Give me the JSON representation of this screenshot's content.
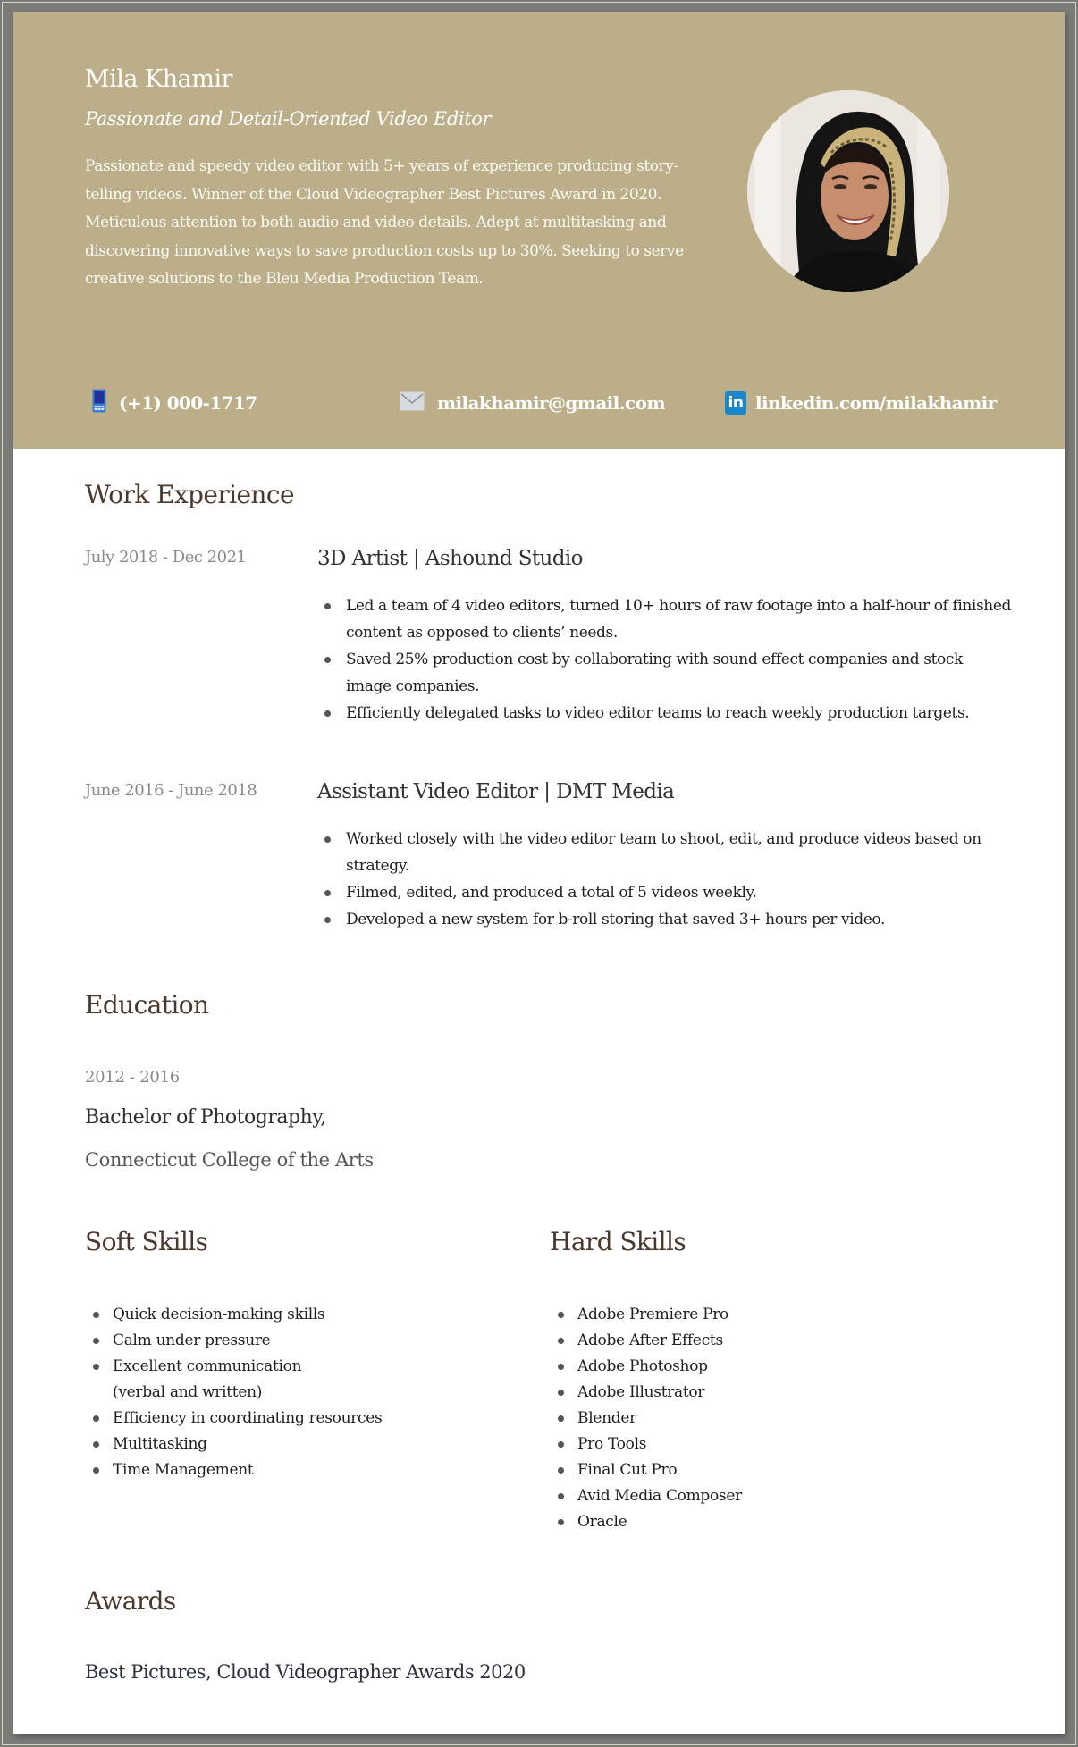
{
  "header": {
    "name": "Mila Khamir",
    "tagline": "Passionate and Detail-Oriented Video Editor",
    "summary": "Passionate and speedy video editor with 5+ years of experience producing story-telling videos. Winner of the Cloud Videographer Best Pictures Award in 2020. Meticulous attention to both audio and video details.  Adept at multitasking and discovering innovative ways to save production costs up to 30%. Seeking to serve creative solutions to the Bleu Media Production Team.",
    "photo_alt": "Profile photo of Mila Khamir",
    "contacts": {
      "phone": {
        "icon": "mobile-phone-icon",
        "text": "(+1) 000-1717"
      },
      "email": {
        "icon": "envelope-icon",
        "text": "milakhamir@gmail.com"
      },
      "linkedin": {
        "icon": "linkedin-icon",
        "icon_glyph": "in",
        "text": "linkedin.com/milakhamir"
      }
    }
  },
  "colors": {
    "header_band": "#bcae89",
    "section_heading": "#4b372c",
    "date_text": "#8a8a8a",
    "linkedin_blue": "#1b86c8",
    "phone_blue": "#2a3fa0"
  },
  "work_experience": {
    "title": "Work Experience",
    "jobs": [
      {
        "dates": "July 2018 - Dec 2021",
        "title": "3D Artist | Ashound Studio",
        "bullets": [
          "Led a team of 4 video editors, turned 10+ hours of raw footage into a half-hour of finished content as opposed to clients’ needs.",
          "Saved 25% production cost by collaborating with sound effect companies and stock image companies.",
          "Efficiently delegated tasks to video editor teams to reach weekly production targets."
        ]
      },
      {
        "dates": "June 2016 - June 2018",
        "title": "Assistant Video Editor | DMT Media",
        "bullets": [
          "Worked closely with the video editor team to shoot, edit, and produce videos based on strategy.",
          "Filmed, edited, and produced a total of 5 videos weekly.",
          "Developed a new system for b-roll storing that saved 3+ hours per video."
        ]
      }
    ]
  },
  "education": {
    "title": "Education",
    "dates": "2012 - 2016",
    "degree": "Bachelor of Photography,",
    "school": "Connecticut College of the Arts"
  },
  "soft_skills": {
    "title": "Soft Skills",
    "items": [
      "Quick decision-making skills",
      "Calm under pressure",
      "Excellent communication (verbal and written)",
      "Efficiency in coordinating resources",
      "Multitasking",
      "Time Management"
    ]
  },
  "hard_skills": {
    "title": "Hard Skills",
    "items": [
      "Adobe Premiere Pro",
      "Adobe After Effects",
      "Adobe Photoshop",
      "Adobe Illustrator",
      "Blender",
      "Pro Tools",
      "Final Cut Pro",
      "Avid Media Composer",
      "Oracle"
    ]
  },
  "awards": {
    "title": "Awards",
    "items": [
      "Best Pictures, Cloud Videographer Awards 2020"
    ]
  }
}
